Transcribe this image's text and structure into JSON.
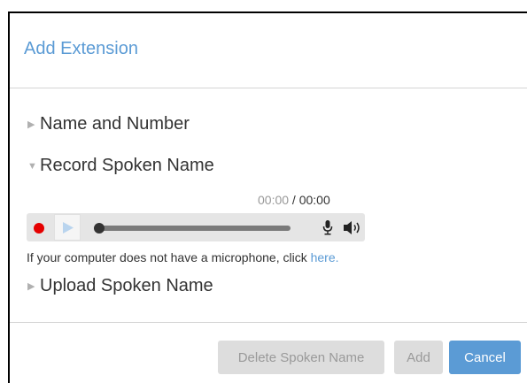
{
  "dialog": {
    "title": "Add Extension"
  },
  "sections": {
    "name_number": {
      "label": "Name and Number",
      "expanded": false
    },
    "record": {
      "label": "Record Spoken Name",
      "expanded": true
    },
    "upload": {
      "label": "Upload Spoken Name",
      "expanded": false
    }
  },
  "player": {
    "current_time": "00:00",
    "separator": " / ",
    "total_time": "00:00",
    "progress": 0
  },
  "note": {
    "text": "If your computer does not have a microphone, click ",
    "link_text": "here."
  },
  "buttons": {
    "delete_label": "Delete Spoken Name",
    "add_label": "Add",
    "cancel_label": "Cancel"
  },
  "colors": {
    "accent": "#5b9bd5",
    "record": "#e50000",
    "disabled_bg": "#dddddd"
  },
  "icons": {
    "collapsed": "caret-right-icon",
    "expanded": "caret-down-icon",
    "record": "record-icon",
    "play": "play-icon",
    "mic": "microphone-icon",
    "volume": "speaker-icon"
  }
}
